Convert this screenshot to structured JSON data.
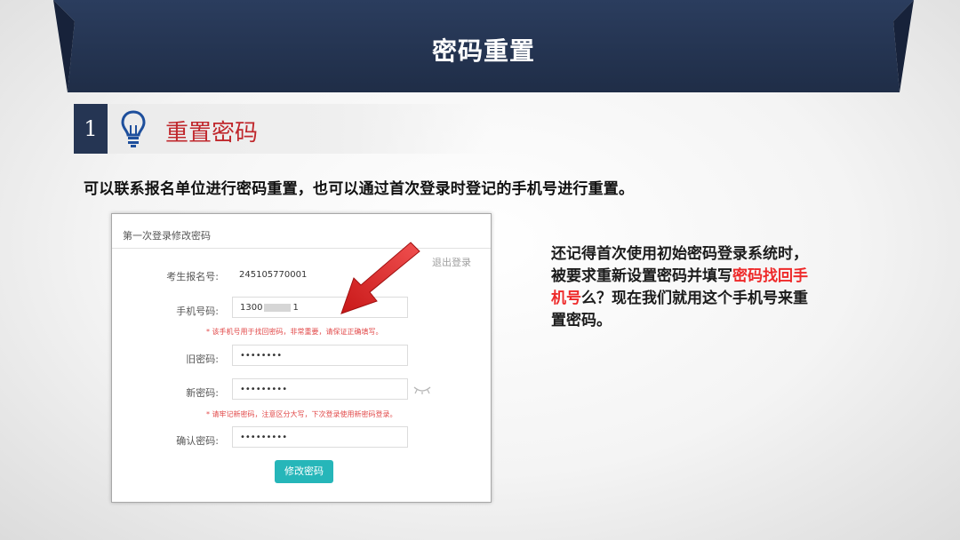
{
  "slide": {
    "title": "密码重置",
    "section_number": "1",
    "section_title": "重置密码",
    "intro": "可以联系报名单位进行密码重置，也可以通过首次登录时登记的手机号进行重置。"
  },
  "screenshot": {
    "form_title": "第一次登录修改密码",
    "logout_link": "退出登录",
    "fields": {
      "exam_id_label": "考生报名号:",
      "exam_id_value": "245105770001",
      "phone_label": "手机号码:",
      "phone_value_prefix": "1300",
      "phone_value_suffix": "1",
      "phone_note": "* 该手机号用于找回密码，非常重要，请保证正确填写。",
      "old_password_label": "旧密码:",
      "old_password_value": "••••••••",
      "new_password_label": "新密码:",
      "new_password_value": "•••••••••",
      "password_note": "* 请牢记新密码，注意区分大写，下次登录使用新密码登录。",
      "confirm_password_label": "确认密码:",
      "confirm_password_value": "•••••••••"
    },
    "submit_label": "修改密码"
  },
  "description": {
    "part1": "还记得首次使用初始密码登录系统时，被要求重新设置密码并填写",
    "highlight": "密码找回手机号",
    "part2": "么？现在我们就用这个手机号来重置密码。"
  },
  "colors": {
    "banner": "#253553",
    "section_title": "#c0282d",
    "highlight": "#ee2a2a",
    "button": "#26b6b9"
  },
  "icons": {
    "section": "lightbulb-icon",
    "arrow": "red-arrow-icon",
    "password_toggle": "eye-closed-icon"
  }
}
